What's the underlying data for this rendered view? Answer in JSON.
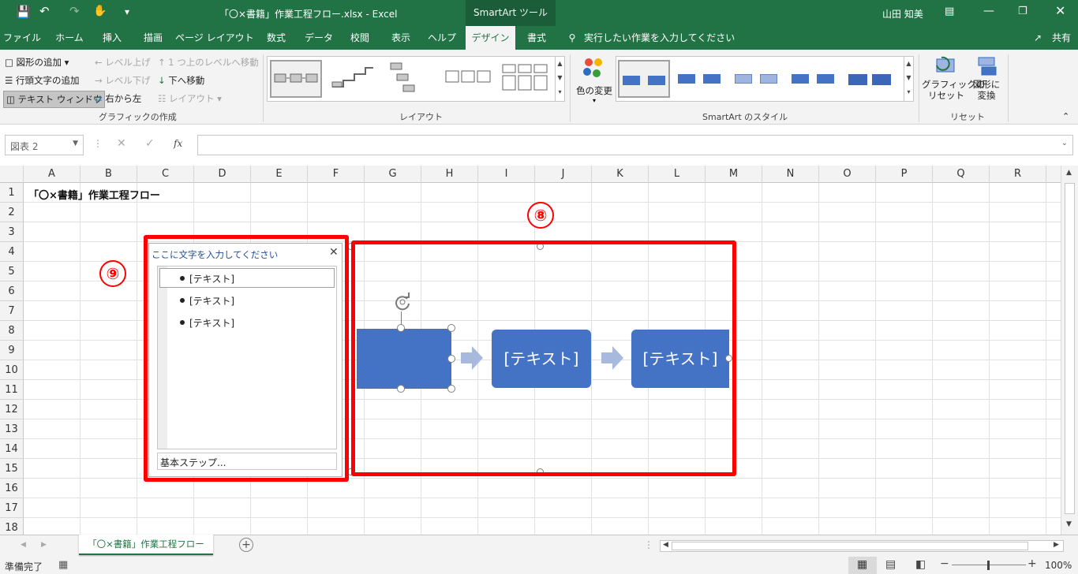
{
  "titlebar": {
    "filename": "「〇×書籍」作業工程フロー.xlsx  -  Excel",
    "context_tab": "SmartArt ツール",
    "user": "山田 知美"
  },
  "tabs": [
    "ファイル",
    "ホーム",
    "挿入",
    "描画",
    "ページ レイアウト",
    "数式",
    "データ",
    "校閲",
    "表示",
    "ヘルプ",
    "デザイン",
    "書式"
  ],
  "tell_me": "実行したい作業を入力してください",
  "share": "共有",
  "ribbon": {
    "create": {
      "add_shape": "図形の追加",
      "add_bullet": "行頭文字の追加",
      "text_pane": "テキスト ウィンドウ",
      "promote": "レベル上げ",
      "demote": "レベル下げ",
      "right_to_left": "右から左",
      "move_up": "1 つ上のレベルへ移動",
      "move_down": "下へ移動",
      "layout": "レイアウト",
      "group": "グラフィックの作成"
    },
    "layouts_group": "レイアウト",
    "change_colors": "色の変更",
    "styles_group": "SmartArt のスタイル",
    "reset_graphic_1": "グラフィックの",
    "reset_graphic_2": "リセット",
    "convert_1": "図形に",
    "convert_2": "変換",
    "reset_group": "リセット"
  },
  "namebox": "図表 2",
  "columns": [
    "A",
    "B",
    "C",
    "D",
    "E",
    "F",
    "G",
    "H",
    "I",
    "J",
    "K",
    "L",
    "M",
    "N",
    "O",
    "P",
    "Q",
    "R"
  ],
  "rows": [
    "1",
    "2",
    "3",
    "4",
    "5",
    "6",
    "7",
    "8",
    "9",
    "10",
    "11",
    "12",
    "13",
    "14",
    "15",
    "16",
    "17",
    "18"
  ],
  "cell_a1": "「〇×書籍」作業工程フロー",
  "callouts": {
    "eight": "⑧",
    "nine": "⑨"
  },
  "smartart": {
    "shape2": "[テキスト]",
    "shape3": "[テキスト]"
  },
  "text_pane": {
    "title": "ここに文字を入力してください",
    "items": [
      "[テキスト]",
      "[テキスト]",
      "[テキスト]"
    ],
    "footer": "基本ステップ..."
  },
  "sheet_tab": "「〇×書籍」作業工程フロー",
  "status": {
    "ready": "準備完了",
    "zoom": "100%"
  },
  "colors": {
    "excel_green": "#217346",
    "shape_blue": "#4472c4",
    "callout_red": "#ff0000"
  }
}
